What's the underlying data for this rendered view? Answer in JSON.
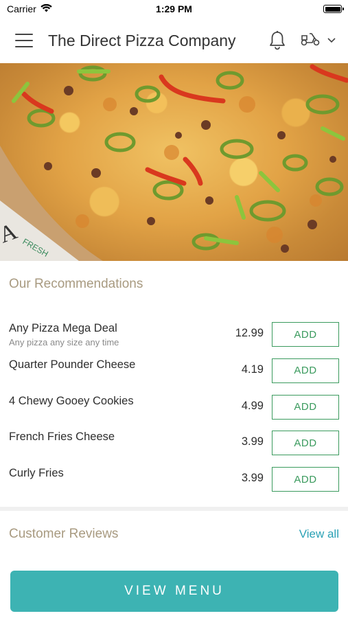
{
  "status_bar": {
    "carrier": "Carrier",
    "time": "1:29 PM"
  },
  "header": {
    "title": "The Direct Pizza Company",
    "icons": [
      "hamburger-menu-icon",
      "bell-icon",
      "scooter-icon",
      "chevron-down-icon"
    ]
  },
  "hero": {
    "image": "pizza-photo"
  },
  "recommendations": {
    "title": "Our Recommendations",
    "items": [
      {
        "name": "Any Pizza Mega Deal",
        "description": "Any pizza any size any time",
        "price": "12.99",
        "button": "ADD"
      },
      {
        "name": "Quarter Pounder Cheese",
        "description": "",
        "price": "4.19",
        "button": "ADD"
      },
      {
        "name": "4 Chewy Gooey Cookies",
        "description": "",
        "price": "4.99",
        "button": "ADD"
      },
      {
        "name": "French Fries Cheese",
        "description": "",
        "price": "3.99",
        "button": "ADD"
      },
      {
        "name": "Curly Fries",
        "description": "",
        "price": "3.99",
        "button": "ADD"
      }
    ]
  },
  "reviews": {
    "title": "Customer Reviews",
    "view_all": "View all"
  },
  "cta": {
    "label": "VIEW MENU"
  },
  "colors": {
    "accent_teal": "#3db3b3",
    "add_green": "#3a9a5d",
    "link_blue": "#2aa1b5",
    "section_title": "#a89a80"
  }
}
